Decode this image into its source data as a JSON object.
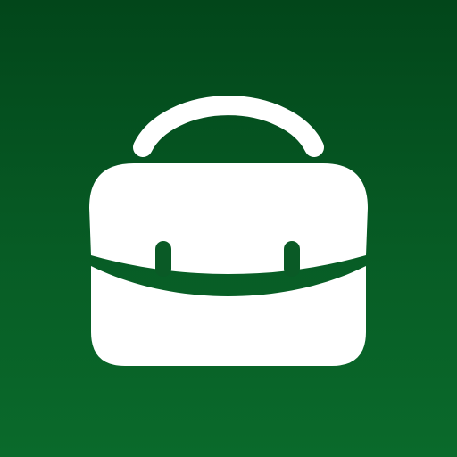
{
  "icon": {
    "name": "briefcase-icon",
    "glyph_color": "#ffffff",
    "background_top": "#02461a",
    "background_bottom": "#0a6a2b"
  }
}
